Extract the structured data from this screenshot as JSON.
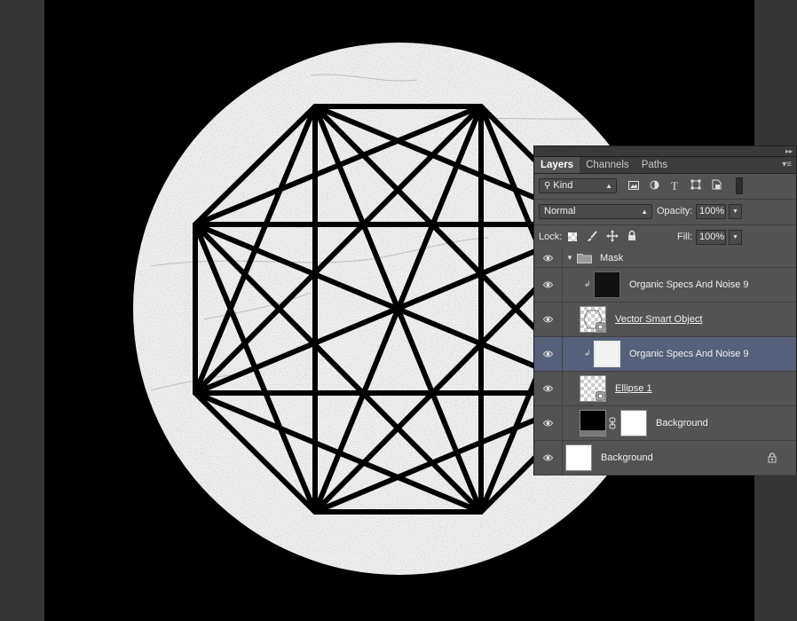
{
  "panel": {
    "tabs": [
      {
        "label": "Layers",
        "active": true
      },
      {
        "label": "Channels",
        "active": false
      },
      {
        "label": "Paths",
        "active": false
      }
    ],
    "filter": {
      "kind_label": "Kind"
    },
    "blend_mode": "Normal",
    "opacity_label": "Opacity:",
    "opacity_value": "100%",
    "lock_label": "Lock:",
    "fill_label": "Fill:",
    "fill_value": "100%"
  },
  "layers": [
    {
      "name": "Mask",
      "type": "group"
    },
    {
      "name": "Organic Specs And Noise 9",
      "type": "clipped"
    },
    {
      "name": "Vector Smart Object",
      "type": "smart-object"
    },
    {
      "name": "Organic Specs And Noise 9",
      "type": "clipped",
      "selected": true
    },
    {
      "name": "Ellipse 1",
      "type": "shape"
    },
    {
      "name": "Background",
      "type": "masked"
    },
    {
      "name": "Background",
      "type": "background",
      "locked": true
    }
  ],
  "colors": {
    "canvas": "#000000",
    "selected_layer": "#55607a",
    "panel": "#535353"
  }
}
